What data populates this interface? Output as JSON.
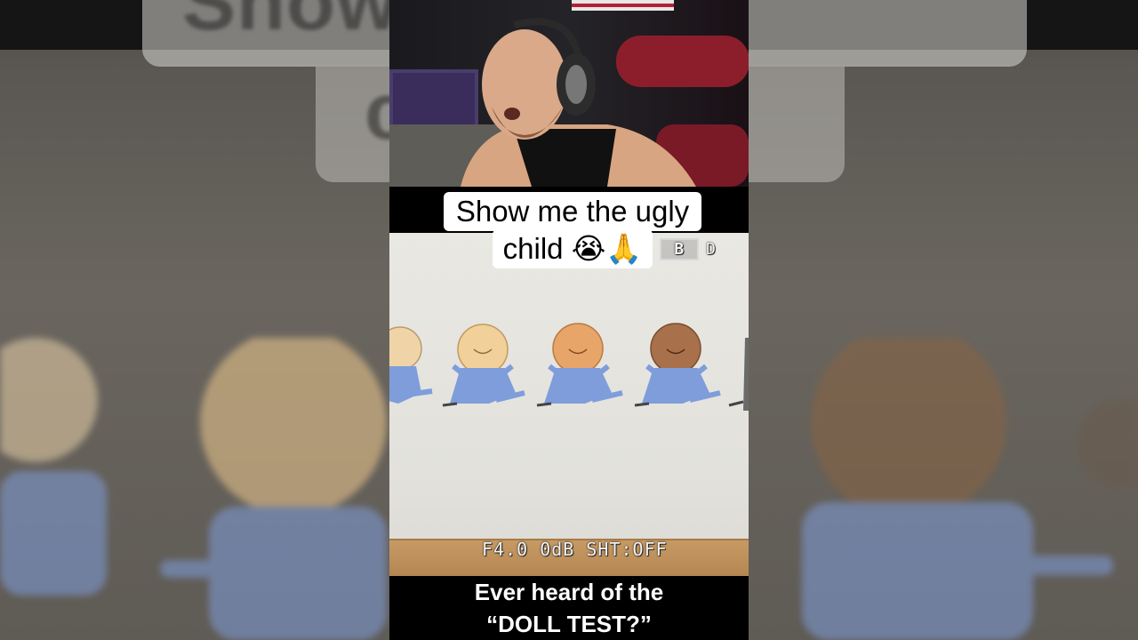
{
  "caption": {
    "line1": "Show me the ugly",
    "line2": "child 😭🙏"
  },
  "video_osd": {
    "bottom_readout": "F4.0  0dB  SHT:OFF",
    "top_badge": "B",
    "top_text": "D"
  },
  "subtitle": {
    "line1": "Ever heard of the",
    "line2": "“DOLL TEST?”"
  },
  "backdrop_text": {
    "top": "Show       e ugly",
    "second": "c"
  },
  "colors": {
    "doll_suit": "#7f9ddb",
    "doll_hair_1": "#f0d4a8",
    "doll_hair_2": "#f1d09a",
    "doll_hair_3": "#e8a56a",
    "doll_hair_4": "#a8714b",
    "floor": "#c79a64",
    "chair": "#8c1e2c"
  }
}
